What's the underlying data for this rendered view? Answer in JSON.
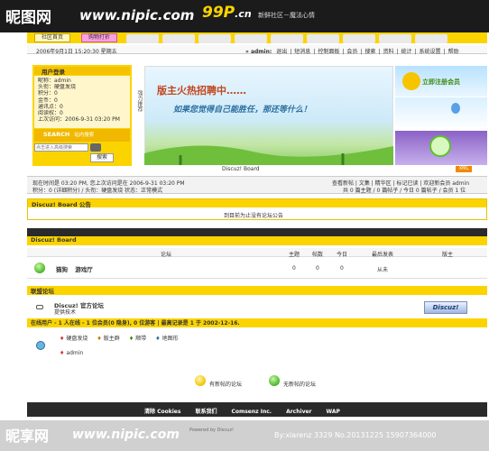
{
  "watermark_top": {
    "logo_text": "昵图网",
    "url": "www.nipic.com"
  },
  "brand": {
    "logo": "99P",
    "cn_suffix": ".cn",
    "tagline": "新鲜社区－魔法心情"
  },
  "tabs": [
    {
      "label": "社区首页"
    },
    {
      "label": "购物打折"
    }
  ],
  "datebar": {
    "date": "2006年9月1日 15:20:30 星期五"
  },
  "topnav": {
    "user": "» admin:",
    "items": [
      "退出",
      "短消息",
      "控制面板",
      "会员",
      "搜索",
      "资料",
      "统计",
      "系统设置",
      "帮助"
    ]
  },
  "login": {
    "title": "用户登录",
    "lines": [
      "昵称：admin",
      "头衔：硬盘发烧",
      "积分：0",
      "金币：0",
      "通讯点：0",
      "阅读权：0",
      "上次访问：2006-9-31 03:20 PM"
    ],
    "search_title": "SEARCH",
    "search_sub": "站内搜索",
    "search_placeholder": "点击进入高级搜索",
    "search_button": "搜索"
  },
  "banner": {
    "vertical": "强力推荐",
    "headline1": "版主火热招聘中……",
    "headline2": "如果您觉得自己能胜任，那还等什么！",
    "caption": "Discuz! Board",
    "right_text": "立即注册会员"
  },
  "status": {
    "line1": "现在时间是 03:20 PM, 您上次访问是在 2006-9-31 03:20 PM",
    "line1_right": "查看新帖 | 文集 | 精华区 | 标记已读 | 欢迎新会员 admin",
    "line2": "积分：0 (详细积分) / 头衔：硬盘发烧 状态：正常模式",
    "line2_right": "共 0 篇主题 / 0 篇帖子 / 今日 0 篇帖子 / 会员 1 位"
  },
  "notice": {
    "title": "Discuz! Board 公告",
    "body": "到目前为止没有论坛公告"
  },
  "board": {
    "title": "Discuz! Board",
    "headers": [
      "论坛",
      "主题",
      "帖数",
      "今日",
      "最后发表",
      "版主"
    ],
    "rows": [
      {
        "name": "猫狗",
        "sub": "游戏厅",
        "topics": "0",
        "posts": "0",
        "today": "0",
        "last": "从未",
        "mods": ""
      }
    ]
  },
  "links": {
    "title": "联盟论坛",
    "name": "Discuz! 官方论坛",
    "sub": "提供技术",
    "badge": "Discuz!"
  },
  "online": {
    "title": "在线用户 - 1 人在线 - 1 位会员(0 隐身), 0 位游客 | 最高记录是 1 于 2002-12-16.",
    "groups": [
      "硬盘发烧",
      "版主群",
      "顺带",
      "地图形"
    ],
    "users": [
      "admin"
    ]
  },
  "legend": {
    "new": "有新帖的论坛",
    "nonew": "无新帖的论坛"
  },
  "footer": {
    "links": [
      "清除 Cookies",
      "联系我们",
      "Comsenz Inc.",
      "Archiver",
      "WAP"
    ],
    "powered": "Powered by Discuz!"
  },
  "watermark_bottom": {
    "logo_text": "昵享网",
    "url": "www.nipic.com",
    "id": "By:xiarenz 3329 No.20131225 15907364000"
  }
}
